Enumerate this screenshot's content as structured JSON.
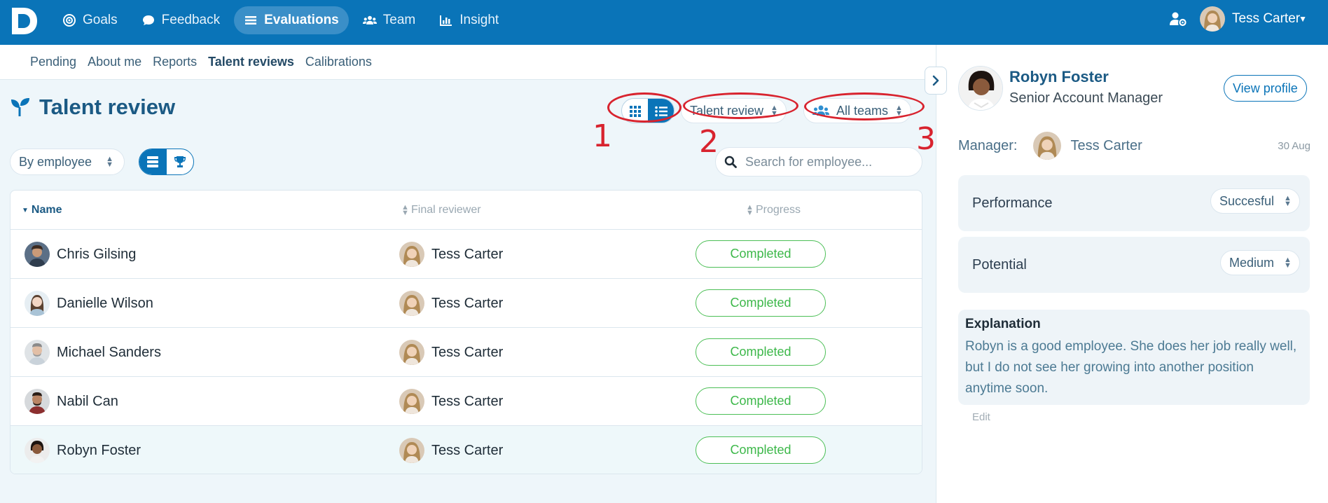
{
  "topnav": {
    "logo": "D",
    "items": [
      {
        "label": "Goals",
        "icon": "target-icon"
      },
      {
        "label": "Feedback",
        "icon": "chat-bubble-icon"
      },
      {
        "label": "Evaluations",
        "icon": "list-icon",
        "active": true
      },
      {
        "label": "Team",
        "icon": "users-icon"
      },
      {
        "label": "Insight",
        "icon": "bar-chart-icon"
      }
    ],
    "user_name": "Tess Carter"
  },
  "subnav": {
    "items": [
      "Pending",
      "About me",
      "Reports",
      "Talent reviews",
      "Calibrations"
    ],
    "selected": "Talent reviews"
  },
  "page": {
    "title": "Talent review",
    "review_type_select": "Talent review",
    "team_select": "All teams",
    "group_by_select": "By employee",
    "search_placeholder": "Search for employee..."
  },
  "annotations": {
    "one": "1",
    "two": "2",
    "three": "3"
  },
  "table": {
    "columns": [
      "Name",
      "Final reviewer",
      "Progress"
    ],
    "rows": [
      {
        "name": "Chris Gilsing",
        "reviewer": "Tess Carter",
        "progress": "Completed"
      },
      {
        "name": "Danielle Wilson",
        "reviewer": "Tess Carter",
        "progress": "Completed"
      },
      {
        "name": "Michael Sanders",
        "reviewer": "Tess Carter",
        "progress": "Completed"
      },
      {
        "name": "Nabil Can",
        "reviewer": "Tess Carter",
        "progress": "Completed"
      },
      {
        "name": "Robyn Foster",
        "reviewer": "Tess Carter",
        "progress": "Completed"
      }
    ]
  },
  "panel": {
    "name": "Robyn Foster",
    "role": "Senior Account Manager",
    "view_profile": "View profile",
    "manager_label": "Manager:",
    "manager_name": "Tess Carter",
    "date": "30 Aug",
    "performance_label": "Performance",
    "performance_value": "Succesful",
    "potential_label": "Potential",
    "potential_value": "Medium",
    "explanation_title": "Explanation",
    "explanation_text": "Robyn is a good employee. She does her job really well, but I do not see her growing into another position anytime soon.",
    "edit": "Edit"
  },
  "colors": {
    "brand": "#0a74b8",
    "completed": "#3db84a",
    "annotation": "#d8232e"
  }
}
